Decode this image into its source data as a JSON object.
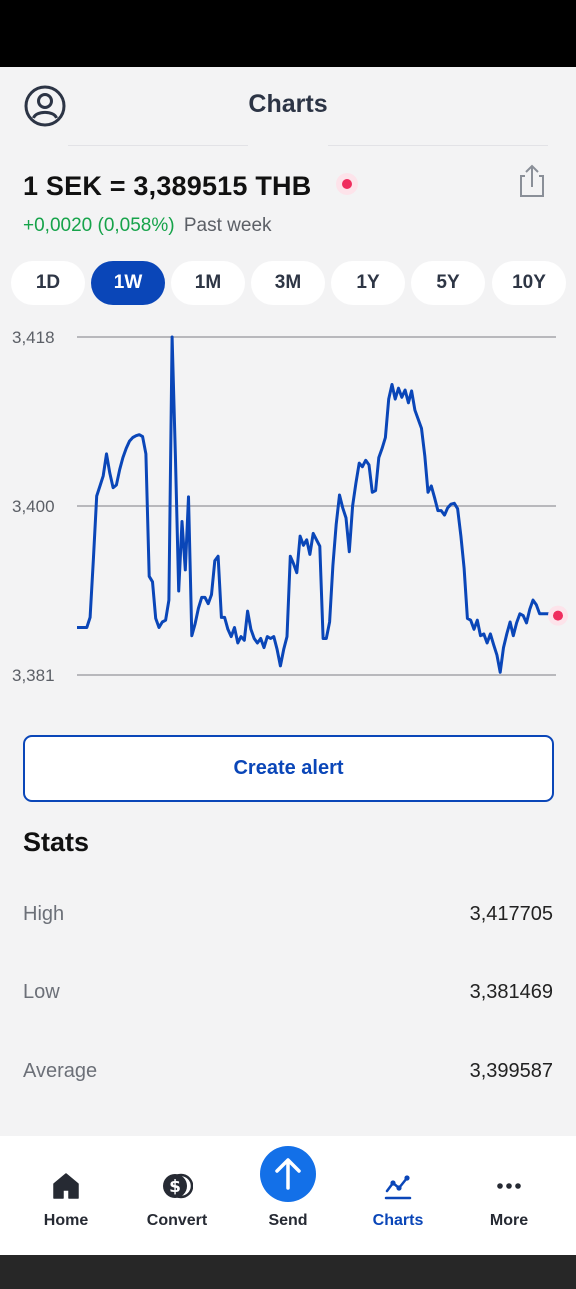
{
  "header": {
    "title": "Charts"
  },
  "rate": {
    "title": "1 SEK = 3,389515 THB",
    "change": "+0,0020 (0,058%)",
    "period": "Past week"
  },
  "period_tabs": [
    {
      "label": "1D",
      "active": false
    },
    {
      "label": "1W",
      "active": true
    },
    {
      "label": "1M",
      "active": false
    },
    {
      "label": "3M",
      "active": false
    },
    {
      "label": "1Y",
      "active": false
    },
    {
      "label": "5Y",
      "active": false
    },
    {
      "label": "10Y",
      "active": false
    }
  ],
  "chart_data": {
    "type": "line",
    "yticks": [
      "3,418",
      "3,400",
      "3,381"
    ],
    "ylim": [
      3.381,
      3.418
    ],
    "grid": true,
    "line_color": "#0a46b8",
    "marker_color": "#ef2d5e",
    "series": [
      {
        "values": [
          3.3862,
          3.3862,
          3.3862,
          3.3862,
          3.3873,
          3.3937,
          3.4006,
          3.4017,
          3.4028,
          3.4052,
          3.4031,
          3.4015,
          3.4018,
          3.4035,
          3.4048,
          3.4058,
          3.4066,
          3.407,
          3.4072,
          3.4073,
          3.4071,
          3.4052,
          3.3918,
          3.3912,
          3.3872,
          3.3862,
          3.3868,
          3.387,
          3.3892,
          3.418,
          3.405,
          3.3902,
          3.3978,
          3.3925,
          3.4005,
          3.3853,
          3.3866,
          3.3883,
          3.3895,
          3.3895,
          3.3888,
          3.3898,
          3.3935,
          3.394,
          3.3873,
          3.3873,
          3.386,
          3.3852,
          3.3862,
          3.3845,
          3.3852,
          3.3848,
          3.388,
          3.386,
          3.385,
          3.3845,
          3.385,
          3.384,
          3.3852,
          3.385,
          3.3852,
          3.3838,
          3.382,
          3.3838,
          3.3852,
          3.394,
          3.3932,
          3.3922,
          3.3962,
          3.3952,
          3.3958,
          3.3942,
          3.3965,
          3.3958,
          3.3951,
          3.385,
          3.385,
          3.3868,
          3.393,
          3.3975,
          3.4007,
          3.3993,
          3.3982,
          3.3945,
          3.3995,
          3.402,
          3.4042,
          3.4038,
          3.4045,
          3.404,
          3.401,
          3.4012,
          3.4048,
          3.4058,
          3.407,
          3.4112,
          3.4128,
          3.4112,
          3.4124,
          3.4114,
          3.4122,
          3.4108,
          3.4121,
          3.41,
          3.409,
          3.408,
          3.405,
          3.401,
          3.4017,
          3.4004,
          3.399,
          3.399,
          3.3985,
          3.3993,
          3.3997,
          3.3998,
          3.3992,
          3.3962,
          3.3927,
          3.3872,
          3.387,
          3.386,
          3.387,
          3.3853,
          3.3855,
          3.3845,
          3.3855,
          3.3843,
          3.3832,
          3.3813,
          3.384,
          3.3855,
          3.3868,
          3.3853,
          3.3867,
          3.3877,
          3.3875,
          3.3867,
          3.3882,
          3.3892,
          3.3887,
          3.3877,
          3.3877,
          3.3877,
          3.3877,
          3.3875,
          3.3875
        ]
      }
    ]
  },
  "alert_button": {
    "label": "Create alert"
  },
  "stats": {
    "title": "Stats",
    "rows": [
      {
        "label": "High",
        "value": "3,417705"
      },
      {
        "label": "Low",
        "value": "3,381469"
      },
      {
        "label": "Average",
        "value": "3,399587"
      }
    ]
  },
  "nav": {
    "items": [
      {
        "label": "Home",
        "icon": "home-icon",
        "active": false
      },
      {
        "label": "Convert",
        "icon": "dollar-coins-icon",
        "active": false
      },
      {
        "label": "Send",
        "icon": "arrow-up-icon",
        "active": false
      },
      {
        "label": "Charts",
        "icon": "line-chart-icon",
        "active": true
      },
      {
        "label": "More",
        "icon": "more-dots-icon",
        "active": false
      }
    ]
  },
  "colors": {
    "accent": "#0a46b8",
    "positive": "#16a34a",
    "live": "#ef2d5e",
    "send": "#1370e8"
  }
}
